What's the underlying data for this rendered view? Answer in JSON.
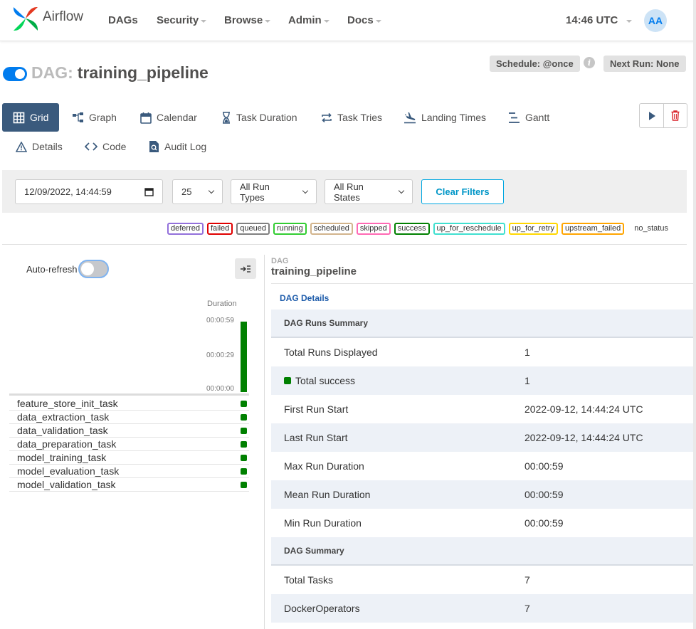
{
  "navbar": {
    "brand": "Airflow",
    "items": [
      {
        "label": "DAGs",
        "dropdown": false
      },
      {
        "label": "Security",
        "dropdown": true
      },
      {
        "label": "Browse",
        "dropdown": true
      },
      {
        "label": "Admin",
        "dropdown": true
      },
      {
        "label": "Docs",
        "dropdown": true
      }
    ],
    "time": "14:46 UTC",
    "avatar": "AA"
  },
  "dag": {
    "prefix": "DAG:",
    "name": "training_pipeline",
    "schedule": "Schedule: @once",
    "next_run": "Next Run: None",
    "active": true
  },
  "tabs": [
    {
      "label": "Grid",
      "icon": "grid-icon",
      "active": true
    },
    {
      "label": "Graph",
      "icon": "graph-icon"
    },
    {
      "label": "Calendar",
      "icon": "calendar-icon"
    },
    {
      "label": "Task Duration",
      "icon": "hourglass-icon"
    },
    {
      "label": "Task Tries",
      "icon": "repeat-icon"
    },
    {
      "label": "Landing Times",
      "icon": "plane-landing-icon"
    },
    {
      "label": "Gantt",
      "icon": "gantt-icon"
    },
    {
      "label": "Details",
      "icon": "warning-triangle-icon"
    },
    {
      "label": "Code",
      "icon": "code-icon"
    },
    {
      "label": "Audit Log",
      "icon": "file-search-icon"
    }
  ],
  "filters": {
    "date": "12/09/2022, 14:44:59",
    "num_runs": "25",
    "run_types": "All Run Types",
    "run_states": "All Run States",
    "clear_label": "Clear Filters"
  },
  "legend": [
    {
      "label": "deferred",
      "color": "#9370db"
    },
    {
      "label": "failed",
      "color": "#e00000"
    },
    {
      "label": "queued",
      "color": "#808080"
    },
    {
      "label": "running",
      "color": "#32cd32"
    },
    {
      "label": "scheduled",
      "color": "#d2b48c"
    },
    {
      "label": "skipped",
      "color": "#ff69b4"
    },
    {
      "label": "success",
      "color": "#008000"
    },
    {
      "label": "up_for_reschedule",
      "color": "#40e0d0"
    },
    {
      "label": "up_for_retry",
      "color": "#ffd700"
    },
    {
      "label": "upstream_failed",
      "color": "#ffa500"
    },
    {
      "label": "no_status",
      "color": ""
    }
  ],
  "grid": {
    "auto_refresh_label": "Auto-refresh",
    "auto_refresh": false,
    "duration_label": "Duration",
    "duration_ticks": [
      "00:00:59",
      "00:00:29",
      "00:00:00"
    ],
    "tasks": [
      "feature_store_init_task",
      "data_extraction_task",
      "data_validation_task",
      "data_preparation_task",
      "model_training_task",
      "model_evaluation_task",
      "model_validation_task"
    ]
  },
  "details": {
    "kicker": "DAG",
    "title": "training_pipeline",
    "tab": "DAG Details",
    "runs_summary_heading": "DAG Runs Summary",
    "runs_summary": [
      {
        "key": "Total Runs Displayed",
        "value": "1"
      },
      {
        "key": "Total success",
        "value": "1",
        "swatch": "#008000"
      },
      {
        "key": "First Run Start",
        "value": "2022-09-12, 14:44:24 UTC"
      },
      {
        "key": "Last Run Start",
        "value": "2022-09-12, 14:44:24 UTC"
      },
      {
        "key": "Max Run Duration",
        "value": "00:00:59"
      },
      {
        "key": "Mean Run Duration",
        "value": "00:00:59"
      },
      {
        "key": "Min Run Duration",
        "value": "00:00:59"
      }
    ],
    "dag_summary_heading": "DAG Summary",
    "dag_summary": [
      {
        "key": "Total Tasks",
        "value": "7"
      },
      {
        "key": "DockerOperators",
        "value": "7"
      }
    ]
  }
}
